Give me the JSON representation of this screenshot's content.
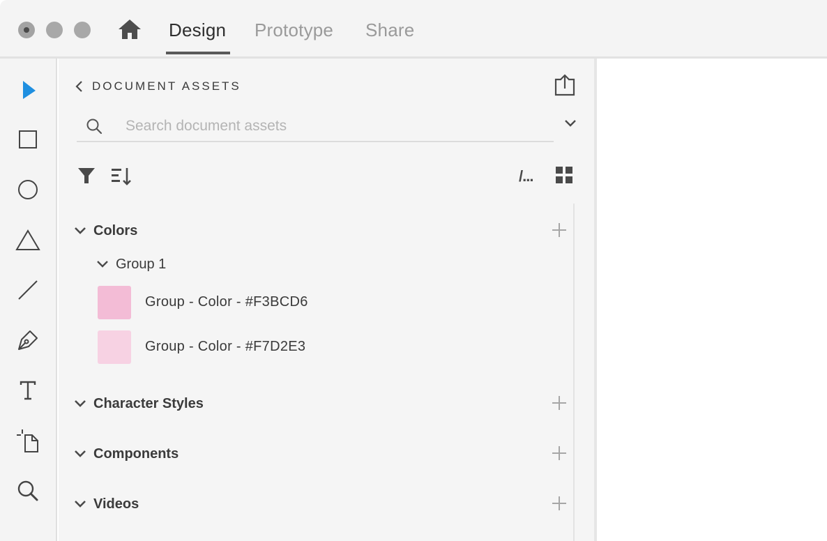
{
  "titlebar": {
    "tabs": [
      {
        "label": "Design",
        "active": true
      },
      {
        "label": "Prototype",
        "active": false
      },
      {
        "label": "Share",
        "active": false
      }
    ]
  },
  "toolbar": {
    "tools": [
      "select-tool",
      "rectangle-tool",
      "ellipse-tool",
      "polygon-tool",
      "line-tool",
      "pen-tool",
      "text-tool",
      "artboard-tool",
      "zoom-tool"
    ],
    "accent_color": "#1f8fe0"
  },
  "assets_panel": {
    "title": "DOCUMENT ASSETS",
    "search": {
      "placeholder": "Search document assets",
      "value": ""
    },
    "view_toggle_list_glyph": "/...",
    "sections": [
      {
        "label": "Colors",
        "expanded": true
      },
      {
        "label": "Character Styles",
        "expanded": true
      },
      {
        "label": "Components",
        "expanded": true
      },
      {
        "label": "Videos",
        "expanded": true
      }
    ],
    "colors": {
      "group_label": "Group 1",
      "items": [
        {
          "label": "Group - Color - #F3BCD6",
          "hex": "#F3BCD6"
        },
        {
          "label": "Group - Color - #F7D2E3",
          "hex": "#F7D2E3"
        }
      ]
    }
  }
}
